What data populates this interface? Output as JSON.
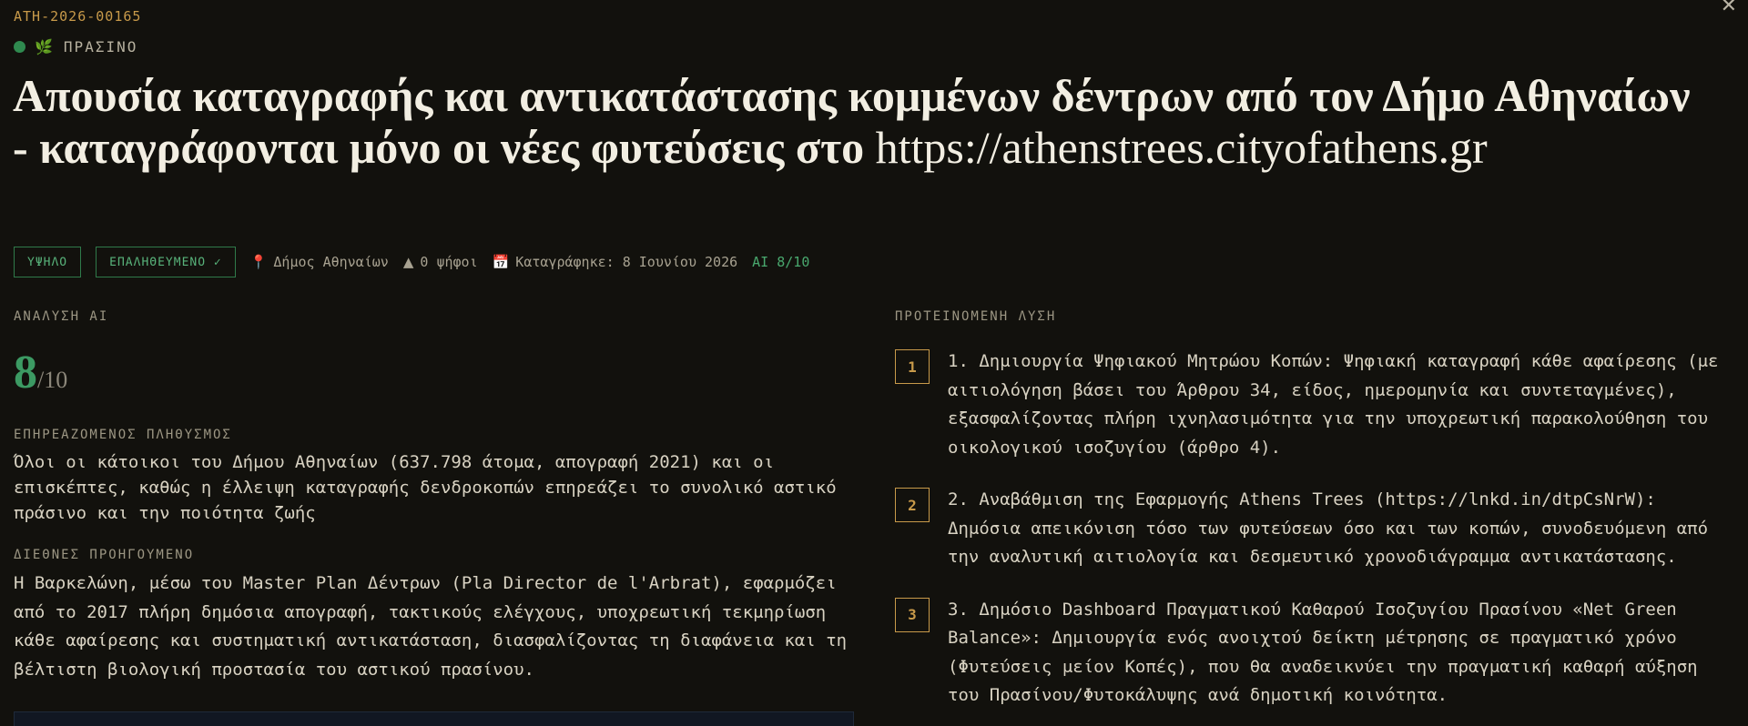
{
  "close_glyph": "✕",
  "ref": "ATH-2026-00165",
  "category": {
    "label": "ΠΡΑΣΙΝΟ",
    "icon": "leaf-icon",
    "status_color": "#2f8a4f"
  },
  "title": {
    "main": "Απουσία καταγραφής και αντικατάστασης κομμένων δέντρων από τον Δήμο Αθηναίων - καταγράφονται μόνο οι νέες φυτεύσεις στο",
    "url": "https://athenstrees.cityofathens.gr"
  },
  "meta": {
    "priority": "ΥΨΗΛΟ",
    "verified": "ΕΠΑΛΗΘΕΥΜΕΝΟ ✓",
    "location": "Δήμος Αθηναίων",
    "votes": "0 ψήφοι",
    "recorded": "Καταγράφηκε: 8 Ιουνίου 2026",
    "ai_score": "AI 8/10"
  },
  "analysis": {
    "label": "ΑΝΑΛΥΣΗ AI",
    "score": "8",
    "score_max": "/10",
    "population_label": "ΕΠΗΡΕΑΖΟΜΕΝΟΣ ΠΛΗΘΥΣΜΟΣ",
    "population_text": "Όλοι οι κάτοικοι του Δήμου Αθηναίων (637.798 άτομα, απογραφή 2021) και οι επισκέπτες, καθώς η έλλειψη καταγραφής δενδροκοπών επηρεάζει το συνολικό αστικό πράσινο και την ποιότητα ζωής",
    "precedent_label": "ΔΙΕΘΝΕΣ ΠΡΟΗΓΟΥΜΕΝΟ",
    "precedent_text": "Η Βαρκελώνη, μέσω του Master Plan Δέντρων (Pla Director de l'Arbrat), εφαρμόζει από το 2017 πλήρη δημόσια απογραφή, τακτικούς ελέγχους, υποχρεωτική τεκμηρίωση κάθε αφαίρεσης και συστηματική αντικατάσταση, διασφαλίζοντας τη διαφάνεια και τη βέλτιστη βιολογική προστασία του αστικού πρασίνου."
  },
  "solution": {
    "label": "ΠΡΟΤΕΙΝΟΜΕΝΗ ΛΥΣΗ",
    "items": [
      {
        "num": "1",
        "text": "1. Δημιουργία Ψηφιακού Μητρώου Κοπών: Ψηφιακή καταγραφή κάθε αφαίρεσης (με αιτιολόγηση βάσει του Άρθρου 34, είδος, ημερομηνία και συντεταγμένες), εξασφαλίζοντας πλήρη ιχνηλασιμότητα για την υποχρεωτική παρακολούθηση του οικολογικού ισοζυγίου (άρθρο 4)."
      },
      {
        "num": "2",
        "text": "2. Αναβάθμιση της Εφαρμογής Athens Trees (https://lnkd.in/dtpCsNrW): Δημόσια απεικόνιση τόσο των φυτεύσεων όσο και των κοπών, συνοδευόμενη από την αναλυτική αιτιολογία και δεσμευτικό χρονοδιάγραμμα αντικατάστασης."
      },
      {
        "num": "3",
        "text": "3. Δημόσιο Dashboard Πραγματικού Καθαρού Ισοζυγίου Πρασίνου «Net Green Balance»: Δημιουργία ενός ανοιχτού δείκτη μέτρησης σε πραγματικό χρόνο (Φυτεύσεις μείον Κοπές), που θα αναδεικνύει την πραγματική καθαρή αύξηση του Πρασίνου/Φυτοκάλυψης ανά δημοτική κοινότητα."
      }
    ]
  }
}
